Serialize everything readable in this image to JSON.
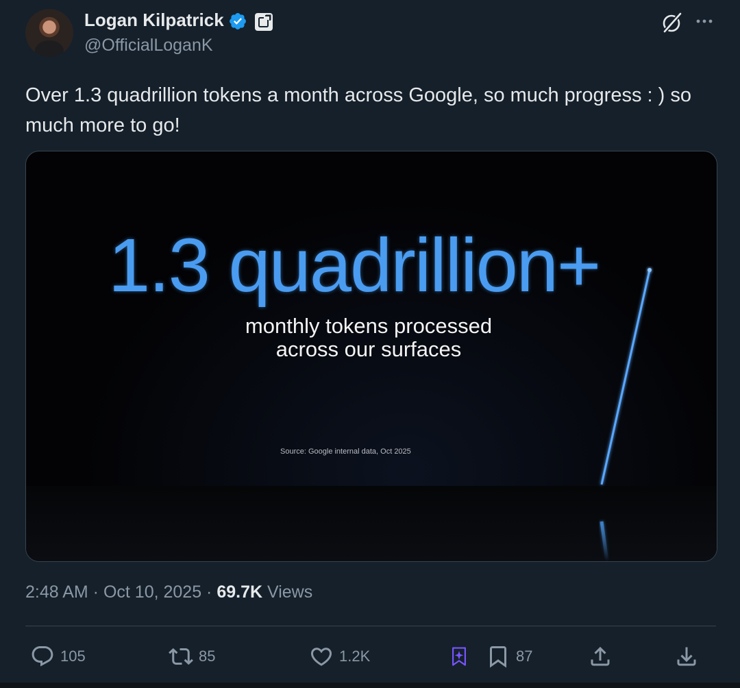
{
  "author": {
    "display_name": "Logan Kilpatrick",
    "handle": "@OfficialLoganK",
    "verified_icon": "verified-badge-icon",
    "affiliate_icon": "affiliate-badge-icon"
  },
  "tweet": {
    "text": "Over 1.3 quadrillion tokens a month across Google, so much progress : ) so much more to go!"
  },
  "media": {
    "headline": "1.3 quadrillion+",
    "subline_1": "monthly tokens processed",
    "subline_2": "across our surfaces",
    "source": "Source: Google internal data, Oct 2025"
  },
  "meta": {
    "time": "2:48 AM",
    "separator": " · ",
    "date": "Oct 10, 2025",
    "views_count": "69.7K",
    "views_label": "Views"
  },
  "actions": {
    "replies": "105",
    "reposts": "85",
    "likes": "1.2K",
    "bookmarks": "87"
  },
  "colors": {
    "background": "#15202b",
    "text_primary": "#e7e9ea",
    "text_secondary": "#8b98a5",
    "verified_blue": "#1d9bf0",
    "headline_blue": "#4a9cf1",
    "grok_purple": "#7856ff"
  }
}
